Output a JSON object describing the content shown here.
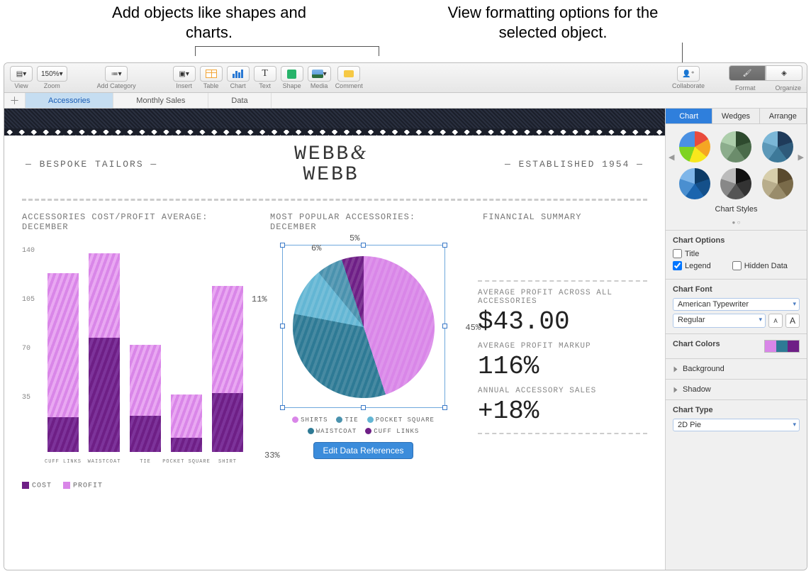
{
  "annotations": {
    "left": "Add objects like shapes and charts.",
    "right": "View formatting options for the selected object."
  },
  "toolbar": {
    "view": "View",
    "zoom_value": "150%",
    "zoom": "Zoom",
    "add_category": "Add Category",
    "insert": "Insert",
    "table": "Table",
    "chart": "Chart",
    "text": "Text",
    "shape": "Shape",
    "media": "Media",
    "comment": "Comment",
    "collaborate": "Collaborate",
    "format": "Format",
    "organize": "Organize"
  },
  "tabs": [
    "Accessories",
    "Monthly Sales",
    "Data"
  ],
  "doc": {
    "left_cap": "— BESPOKE TAILORS —",
    "right_cap": "— ESTABLISHED 1954 —",
    "logo_line1": "WEBB",
    "logo_amp": "&",
    "logo_line2": "WEBB"
  },
  "sections": {
    "bar": "ACCESSORIES COST/PROFIT AVERAGE: DECEMBER",
    "pie": "MOST POPULAR ACCESSORIES: DECEMBER",
    "sum": "FINANCIAL SUMMARY"
  },
  "bar_legend": {
    "cost": "COST",
    "profit": "PROFIT"
  },
  "pie_legend": [
    "SHIRTS",
    "TIE",
    "POCKET SQUARE",
    "WAISTCOAT",
    "CUFF LINKS"
  ],
  "pie_legend_colors": [
    "#d986e8",
    "#4a92ae",
    "#63b6d4",
    "#2e7a95",
    "#6e1f86"
  ],
  "summary": {
    "l1": "AVERAGE PROFIT ACROSS ALL ACCESSORIES",
    "v1": "$43.00",
    "l2": "AVERAGE PROFIT MARKUP",
    "v2": "116%",
    "l3": "ANNUAL ACCESSORY SALES",
    "v3": "+18%"
  },
  "edit_button": "Edit Data References",
  "inspector": {
    "tabs": [
      "Chart",
      "Wedges",
      "Arrange"
    ],
    "styles_label": "Chart Styles",
    "options_label": "Chart Options",
    "cb_title": "Title",
    "cb_legend": "Legend",
    "cb_hidden": "Hidden Data",
    "font_label": "Chart Font",
    "font_name": "American Typewriter",
    "font_style": "Regular",
    "colors_label": "Chart Colors",
    "background": "Background",
    "shadow": "Shadow",
    "type_label": "Chart Type",
    "type_value": "2D Pie"
  },
  "chart_data": [
    {
      "type": "bar",
      "title": "ACCESSORIES COST/PROFIT AVERAGE: DECEMBER",
      "categories": [
        "CUFF LINKS",
        "WAISTCOAT",
        "TIE",
        "POCKET SQUARE",
        "SHIRT"
      ],
      "series": [
        {
          "name": "COST",
          "values": [
            24,
            80,
            25,
            10,
            41
          ],
          "color": "#6e1f86"
        },
        {
          "name": "PROFIT",
          "values": [
            101,
            59,
            50,
            30,
            75
          ],
          "color": "#d986e8"
        }
      ],
      "ylim": [
        0,
        140
      ],
      "yticks": [
        35,
        70,
        105,
        140
      ],
      "xlabel": "",
      "ylabel": ""
    },
    {
      "type": "pie",
      "title": "MOST POPULAR ACCESSORIES: DECEMBER",
      "labels": [
        "SHIRTS",
        "WAISTCOAT",
        "POCKET SQUARE",
        "TIE",
        "CUFF LINKS"
      ],
      "values_pct": [
        45,
        33,
        11,
        6,
        5
      ],
      "colors": [
        "#d986e8",
        "#2e7a95",
        "#63b6d4",
        "#4a92ae",
        "#6e1f86"
      ],
      "label_positions": {
        "45%": "right",
        "33%": "bottom-left",
        "11%": "left",
        "6%": "top-left",
        "5%": "top"
      }
    }
  ]
}
